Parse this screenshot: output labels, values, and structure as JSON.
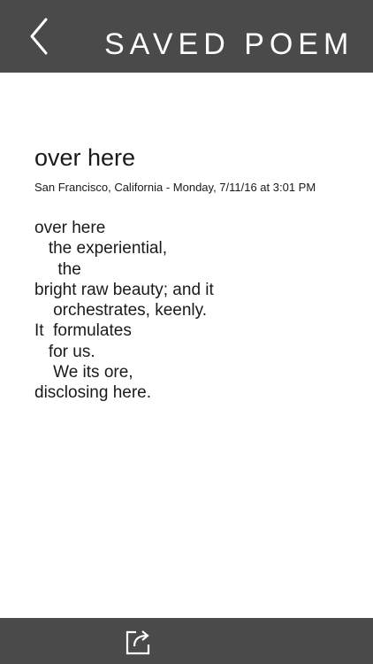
{
  "header": {
    "title": "SAVED POEM",
    "back_icon": "chevron-left-icon"
  },
  "poem": {
    "title": "over here",
    "meta": "San Francisco, California - Monday, 7/11/16 at 3:01 PM",
    "lines": [
      "over here",
      "   the experiential,",
      "     the",
      "bright raw beauty; and it",
      "    orchestrates, keenly.",
      "It  formulates",
      "   for us.",
      "    We its ore,",
      "disclosing here."
    ]
  },
  "footer": {
    "share_icon": "share-export-icon"
  },
  "colors": {
    "bar_background": "#4a4a4a",
    "bar_foreground": "#ffffff",
    "text": "#1a1a1a",
    "page_background": "#ffffff"
  }
}
